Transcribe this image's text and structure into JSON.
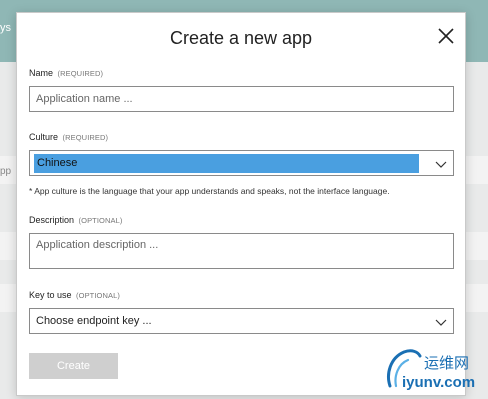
{
  "background": {
    "header_fragment": "ys",
    "side_fragment": "pp"
  },
  "dialog": {
    "title": "Create a new app",
    "close_icon": "close-icon"
  },
  "fields": {
    "name": {
      "label": "Name",
      "requirement": "(REQUIRED)",
      "placeholder": "Application name ...",
      "value": ""
    },
    "culture": {
      "label": "Culture",
      "requirement": "(REQUIRED)",
      "selected": "Chinese",
      "hint": "* App culture is the language that your app understands and speaks, not the interface language."
    },
    "description": {
      "label": "Description",
      "requirement": "(OPTIONAL)",
      "placeholder": "Application description ...",
      "value": ""
    },
    "key": {
      "label": "Key to use",
      "requirement": "(OPTIONAL)",
      "selected": "Choose endpoint key ..."
    }
  },
  "actions": {
    "create_label": "Create"
  },
  "watermark": {
    "cn": "运维网",
    "en": "iyunv.com"
  },
  "colors": {
    "header_bg": "#8fb7b5",
    "selection_highlight": "#4a9fe0",
    "disabled_button": "#cfcfcf",
    "watermark": "#1a6fb3"
  }
}
